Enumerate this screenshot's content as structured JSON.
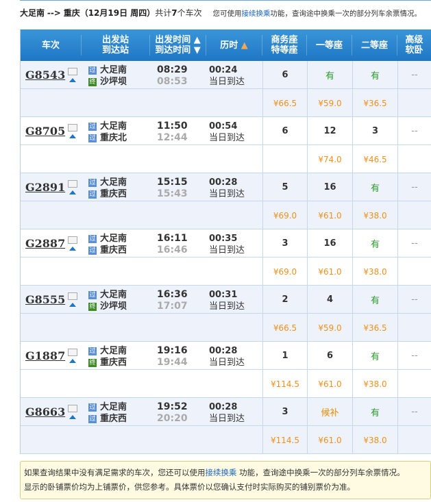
{
  "summary": {
    "from": "大足南",
    "arrow": "-->",
    "to": "重庆",
    "date": "（12月19日  周四）",
    "count_prefix": "共计",
    "count": "7",
    "count_suffix": "个车次",
    "tip_prefix": "您可使用",
    "tip_link": "接续换乘",
    "tip_suffix": "功能，查询途中换乘一次的部分列车余票情况。"
  },
  "header": {
    "train": "车次",
    "from_station": "出发站",
    "to_station": "到达站",
    "depart_time": "出发时间",
    "arrive_time": "到达时间",
    "duration": "历时",
    "business": "商务座",
    "special": "特等座",
    "first": "一等座",
    "second": "二等座",
    "soft1": "高级",
    "soft2": "软卧"
  },
  "trains": [
    {
      "no": "G8543",
      "from": "大足南",
      "from_type": "过",
      "to": "沙坪坝",
      "to_type": "终",
      "dep": "08:29",
      "arr": "08:53",
      "dur": "00:24",
      "day": "当日到达",
      "business": "6",
      "first": "有",
      "second": "有",
      "soft": "--",
      "p_business": "¥66.5",
      "p_first": "¥59.0",
      "p_second": "¥36.5"
    },
    {
      "no": "G8705",
      "from": "大足南",
      "from_type": "过",
      "to": "重庆北",
      "to_type": "过",
      "dep": "11:50",
      "arr": "12:44",
      "dur": "00:54",
      "day": "当日到达",
      "business": "6",
      "first": "12",
      "second": "3",
      "soft": "--",
      "p_business": "",
      "p_first": "¥74.0",
      "p_second": "¥46.5"
    },
    {
      "no": "G2891",
      "from": "大足南",
      "from_type": "过",
      "to": "重庆西",
      "to_type": "过",
      "dep": "15:15",
      "arr": "15:43",
      "dur": "00:28",
      "day": "当日到达",
      "business": "5",
      "first": "16",
      "second": "有",
      "soft": "--",
      "p_business": "¥69.0",
      "p_first": "¥61.0",
      "p_second": "¥38.0"
    },
    {
      "no": "G2887",
      "from": "大足南",
      "from_type": "过",
      "to": "重庆西",
      "to_type": "过",
      "dep": "16:11",
      "arr": "16:46",
      "dur": "00:35",
      "day": "当日到达",
      "business": "3",
      "first": "16",
      "second": "有",
      "soft": "--",
      "p_business": "¥69.0",
      "p_first": "¥61.0",
      "p_second": "¥38.0"
    },
    {
      "no": "G8555",
      "from": "大足南",
      "from_type": "过",
      "to": "沙坪坝",
      "to_type": "终",
      "dep": "16:36",
      "arr": "17:07",
      "dur": "00:31",
      "day": "当日到达",
      "business": "2",
      "first": "4",
      "second": "有",
      "soft": "--",
      "p_business": "¥66.5",
      "p_first": "¥59.0",
      "p_second": "¥36.5"
    },
    {
      "no": "G1887",
      "from": "大足南",
      "from_type": "过",
      "to": "重庆西",
      "to_type": "终",
      "dep": "19:16",
      "arr": "19:44",
      "dur": "00:28",
      "day": "当日到达",
      "business": "1",
      "first": "6",
      "second": "有",
      "soft": "--",
      "p_business": "¥114.5",
      "p_first": "¥61.0",
      "p_second": "¥38.0"
    },
    {
      "no": "G8663",
      "from": "大足南",
      "from_type": "过",
      "to": "重庆西",
      "to_type": "过",
      "dep": "19:52",
      "arr": "20:20",
      "dur": "00:28",
      "day": "当日到达",
      "business": "3",
      "first": "候补",
      "second": "有",
      "soft": "--",
      "p_business": "¥114.5",
      "p_first": "¥61.0",
      "p_second": "¥38.0"
    }
  ],
  "note": {
    "line1_prefix": "如果查询结果中没有满足需求的车次，您还可以使用",
    "link": "接续换乘",
    "line1_suffix": " 功能，查询途中换乘一次的部分列车余票情况。",
    "line2": "显示的卧铺票价均为上铺票价，供您参考。具体票价以您确认支付时实际购买的铺别票价为准。"
  },
  "colors": {
    "header": "#1f77c4",
    "available": "#2c9a2c",
    "price": "#f0901e",
    "link": "#1a65c2"
  }
}
